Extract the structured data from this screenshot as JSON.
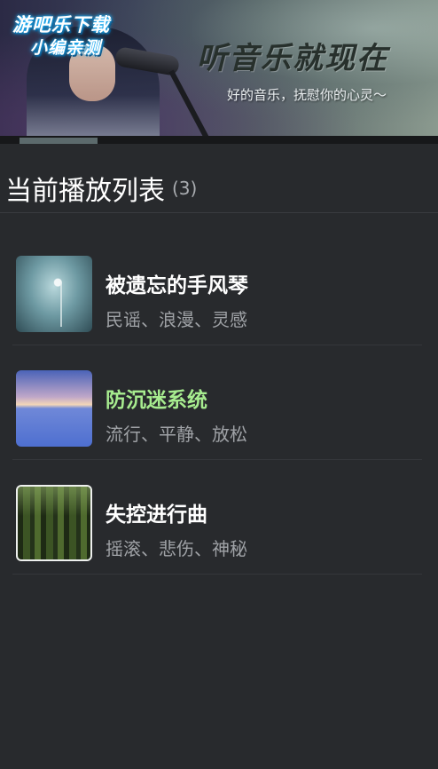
{
  "banner": {
    "logo_line1": "游吧乐下载",
    "logo_line2": "小编亲测",
    "title": "听音乐就现在",
    "subtitle": "好的音乐，抚慰你的心灵～"
  },
  "playlist": {
    "title": "当前播放列表",
    "count": "(3)",
    "items": [
      {
        "title": "被遗忘的手风琴",
        "tags": "民谣、浪漫、灵感",
        "cover_icon": "misty-dandelion-cover",
        "active": false
      },
      {
        "title": "防沉迷系统",
        "tags": "流行、平静、放松",
        "cover_icon": "sunset-lake-cover",
        "active": true
      },
      {
        "title": "失控进行曲",
        "tags": "摇滚、悲伤、神秘",
        "cover_icon": "forest-cover",
        "active": false
      }
    ]
  },
  "colors": {
    "background": "#282a2d",
    "active_title": "#a7ec8f",
    "tag_text": "#9fa2a6"
  }
}
